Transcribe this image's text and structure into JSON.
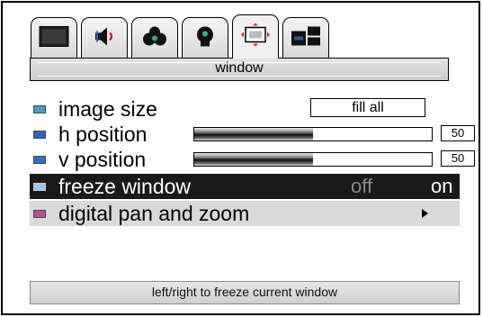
{
  "tabs": [
    {
      "icon": "monitor-icon",
      "active": false
    },
    {
      "icon": "speaker-icon",
      "active": false
    },
    {
      "icon": "color-dots-icon",
      "active": false
    },
    {
      "icon": "lightbulb-icon",
      "active": false
    },
    {
      "icon": "window-frame-icon",
      "active": true
    },
    {
      "icon": "layout-blocks-icon",
      "active": false
    }
  ],
  "menu": {
    "title": "window"
  },
  "rows": {
    "image_size": {
      "label": "image size",
      "value": "fill all"
    },
    "h_position": {
      "label": "h position",
      "value": "50",
      "level": 0.5
    },
    "v_position": {
      "label": "v position",
      "value": "50",
      "level": 0.5
    },
    "freeze_window": {
      "label": "freeze window",
      "off": "off",
      "on": "on"
    },
    "digital_pan_zoom": {
      "label": "digital pan and zoom"
    }
  },
  "hint": "left/right to freeze current window",
  "colors": {
    "selected_row": "#1a1a1a",
    "panel": "#d0d0d0"
  }
}
